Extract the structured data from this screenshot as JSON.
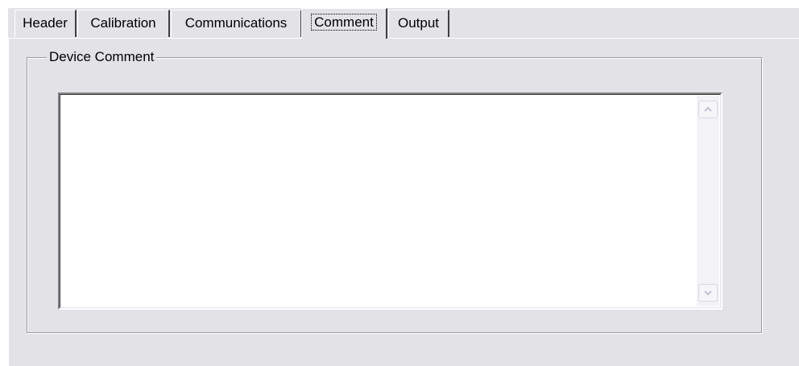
{
  "tabs": [
    {
      "label": "Header",
      "active": false
    },
    {
      "label": "Calibration",
      "active": false
    },
    {
      "label": "Communications",
      "active": false
    },
    {
      "label": "Comment",
      "active": true
    },
    {
      "label": "Output",
      "active": false
    }
  ],
  "group": {
    "title": "Device Comment"
  },
  "comment": {
    "value": ""
  },
  "scrollbar": {
    "up_icon": "scroll-up-arrow-icon",
    "down_icon": "scroll-down-arrow-icon"
  },
  "colors": {
    "panel_background": "#e3e2e7",
    "text_background": "#ffffff",
    "border_dark": "#404040",
    "border_mid": "#808080",
    "arrow_disabled": "#bfc3d3"
  }
}
